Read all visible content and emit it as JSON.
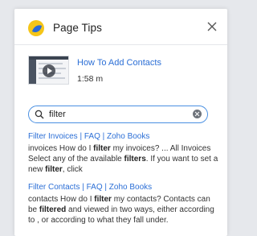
{
  "header": {
    "title": "Page Tips"
  },
  "video": {
    "title": "How To Add Contacts",
    "duration": "1:58 m"
  },
  "search": {
    "value": "filter"
  },
  "results": [
    {
      "title": "Filter Invoices | FAQ | Zoho Books",
      "snippet": [
        "invoices How do I ",
        "filter",
        " my invoices? ... All Invoices Select any of the available ",
        "filters",
        ". If you want to set a new ",
        "filter",
        ", click"
      ]
    },
    {
      "title": "Filter Contacts | FAQ | Zoho Books",
      "snippet": [
        "contacts How do I ",
        "filter",
        " my contacts? Contacts can be ",
        "filtered",
        " and viewed in two ways, either according to , or according to what they fall under."
      ]
    }
  ],
  "colors": {
    "link": "#2c6fd6",
    "search_border": "#4a90e2",
    "logo_yellow": "#f5c518",
    "logo_blue": "#2a6ad8"
  },
  "icons": {
    "logo": "page-tips-logo-icon",
    "close": "close-icon",
    "search": "search-icon",
    "clear": "clear-icon",
    "play": "play-icon"
  }
}
